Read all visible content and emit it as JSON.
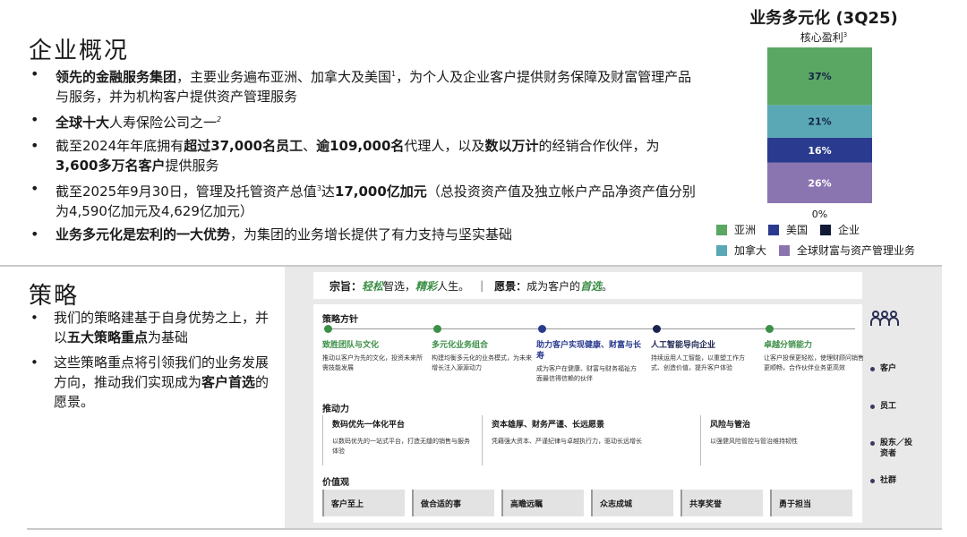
{
  "overview": {
    "title": "企业概况",
    "bullets": [
      {
        "b1": "领先的金融服务集团",
        "t1": "，主要业务遍布亚洲、加拿大及美国",
        "sup": "1",
        "t2": "，为个人及企业客户提供财务保障及财富管理产品与服务，并为机构客户提供资产管理服务"
      },
      {
        "b1": "全球十大",
        "t1": "人寿保险公司之一",
        "sup": "2"
      },
      {
        "t1": "截至2024年年底拥有",
        "b1": "超过37,000名员工",
        "t2": "、",
        "b2": "逾109,000名",
        "t3": "代理人，以及",
        "b3": "数以万计",
        "t4": "的经销合作伙伴，为",
        "b4": "3,600多万名客户",
        "t5": "提供服务"
      },
      {
        "t1": "截至2025年9月30日，管理及托管资产总值",
        "sup": "3",
        "t2": "达",
        "b1": "17,000亿加元",
        "t3": "（总投资资产值及独立帐户产品净资产值分别为4,590亿加元及4,629亿加元）"
      },
      {
        "b1": "业务多元化是宏利的一大优势",
        "t1": "，为集团的业务增长提供了有力支持与坚实基础"
      }
    ]
  },
  "chart_data": {
    "type": "bar",
    "title": "业务多元化 (3Q25)",
    "subtitle": "核心盈利",
    "subtitle_sup": "3",
    "stacked": true,
    "categories": [
      ""
    ],
    "series": [
      {
        "name": "全球财富与资产管理业务",
        "values": [
          26
        ],
        "label": "26%",
        "color": "#8b75b1"
      },
      {
        "name": "企业",
        "values": [
          0
        ],
        "label": "0%",
        "color": "#101a36"
      },
      {
        "name": "美国",
        "values": [
          16
        ],
        "label": "16%",
        "color": "#2a3b8f"
      },
      {
        "name": "加拿大",
        "values": [
          21
        ],
        "label": "21%",
        "color": "#5aa8b6"
      },
      {
        "name": "亚洲",
        "values": [
          37
        ],
        "label": "37%",
        "color": "#5aa763"
      }
    ],
    "legend_order": [
      "亚洲",
      "美国",
      "企业",
      "加拿大",
      "全球财富与资产管理业务"
    ],
    "legend_position": "bottom",
    "ylim": [
      0,
      100
    ],
    "grid": false
  },
  "strategy": {
    "title": "策略",
    "bullets": [
      {
        "t1": "我们的策略建基于自身优势之上，并以",
        "b1": "五大策略重点",
        "t2": "为基础"
      },
      {
        "t1": "这些策略重点将引领我们的业务发展方向，推动我们实现成为",
        "b1": "客户首选",
        "t2": "的愿景。"
      }
    ]
  },
  "panel": {
    "mission_label": "宗旨：",
    "mission_a": "轻松",
    "mission_b": "智选，",
    "mission_c": "精彩",
    "mission_d": "人生。",
    "separator": "|",
    "vision_label": "愿景：",
    "vision_a": "成为客户的",
    "vision_b": "首选",
    "vision_c": "。",
    "guidelines_label": "策略方针",
    "pillars": [
      {
        "title": "致胜团队与文化",
        "desc": "推动以客户为先的文化，投资未来所需技能发展",
        "color": "#3c8f47"
      },
      {
        "title": "多元化业务组合",
        "desc": "构建均衡多元化的业务模式，为未来增长注入源源动力",
        "color": "#3c8f47"
      },
      {
        "title": "助力客户实现健康、财富与长寿",
        "desc": "成为客户在健康、财富与财务福祉方面最信得信赖的伙伴",
        "color": "#2a3b8f"
      },
      {
        "title": "人工智能导向企业",
        "desc": "持续运用人工智能，以重塑工作方式、创造价值，提升客户体验",
        "color": "#1b2451"
      },
      {
        "title": "卓越分销能力",
        "desc": "让客户投保更轻松，使理财顾问销售更顺畅，合作伙伴业务更高效",
        "color": "#3c8f47"
      }
    ],
    "drivers_label": "推动力",
    "drivers": [
      {
        "title": "数码优先一体化平台",
        "desc": "以数码优先的一站式平台，打造无缝的销售与服务体验"
      },
      {
        "title": "资本雄厚、财务严谨、长远愿景",
        "desc": "凭藉强大资本、严谨纪律与卓越执行力，驱动长远增长"
      },
      {
        "title": "风险与管治",
        "desc": "以强健风险管控与管治维持韧性"
      }
    ],
    "values_label": "价值观",
    "values": [
      "客户至上",
      "做合适的事",
      "高瞻远瞩",
      "众志成城",
      "共享奖誉",
      "勇于担当"
    ],
    "stakeholders": [
      "客户",
      "员工",
      "股东／投资者",
      "社群"
    ]
  },
  "icons": {
    "stakeholder_icon": "people-group-icon"
  }
}
